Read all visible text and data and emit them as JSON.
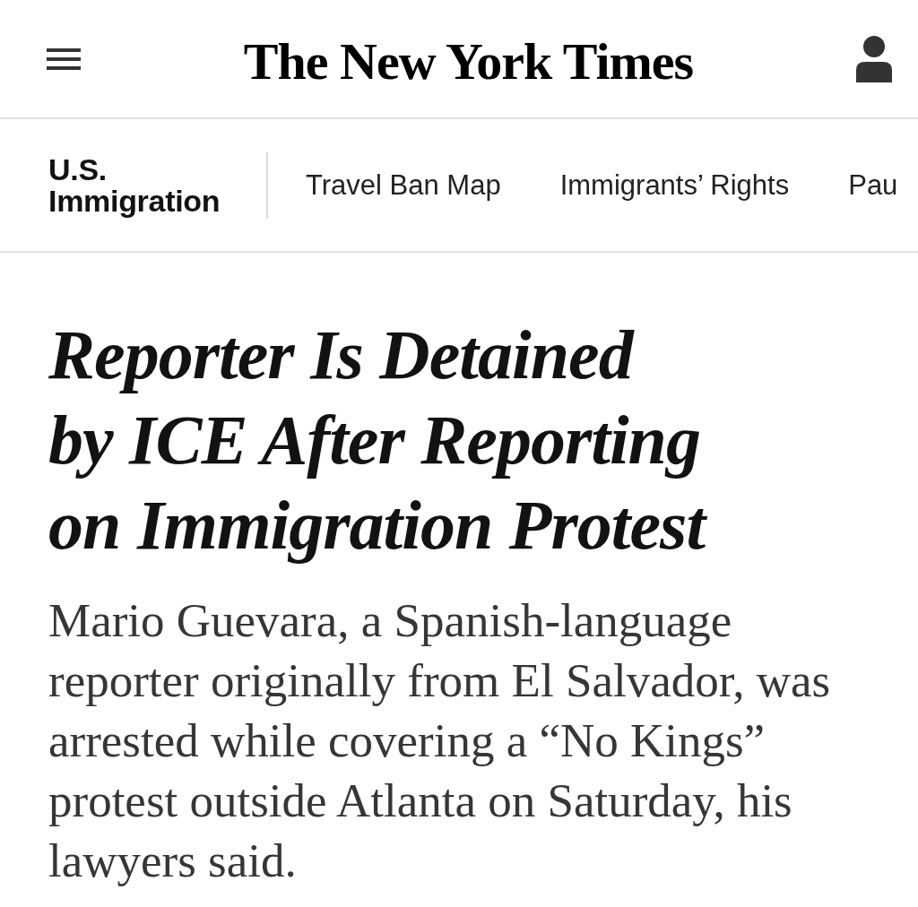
{
  "header": {
    "logo": "The New York Times"
  },
  "section_nav": {
    "section": "U.S. Immigration",
    "links": [
      "Travel Ban Map",
      "Immigrants’ Rights",
      "Pau"
    ]
  },
  "article": {
    "headline": "Reporter Is Detained by ICE After Reporting on Immigration Protest",
    "summary": "Mario Guevara, a Spanish-language reporter originally from El Salvador, was arrested while covering a “No Kings” protest outside Atlanta on Saturday, his lawyers said."
  }
}
